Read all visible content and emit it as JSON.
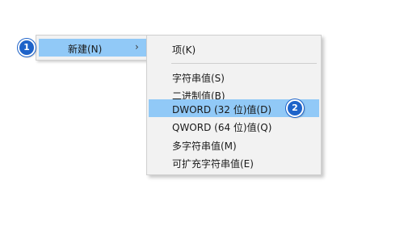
{
  "parent_menu": {
    "item_label": "新建(N)",
    "chevron": "›",
    "chevron_icon": "chevron-right-icon"
  },
  "submenu": {
    "items": [
      {
        "label": "项(K)"
      },
      {
        "label": "字符串值(S)"
      },
      {
        "label": "二进制值(B)"
      },
      {
        "label": "DWORD (32 位)值(D)"
      },
      {
        "label": "QWORD (64 位)值(Q)"
      },
      {
        "label": "多字符串值(M)"
      },
      {
        "label": "可扩充字符串值(E)"
      }
    ],
    "highlighted_index": 3
  },
  "badges": {
    "step1": "1",
    "step2": "2"
  },
  "colors": {
    "menu_background": "#f2f2f2",
    "highlight": "#91c9f7",
    "badge": "#1e63c9",
    "border": "#cfcfcf"
  }
}
